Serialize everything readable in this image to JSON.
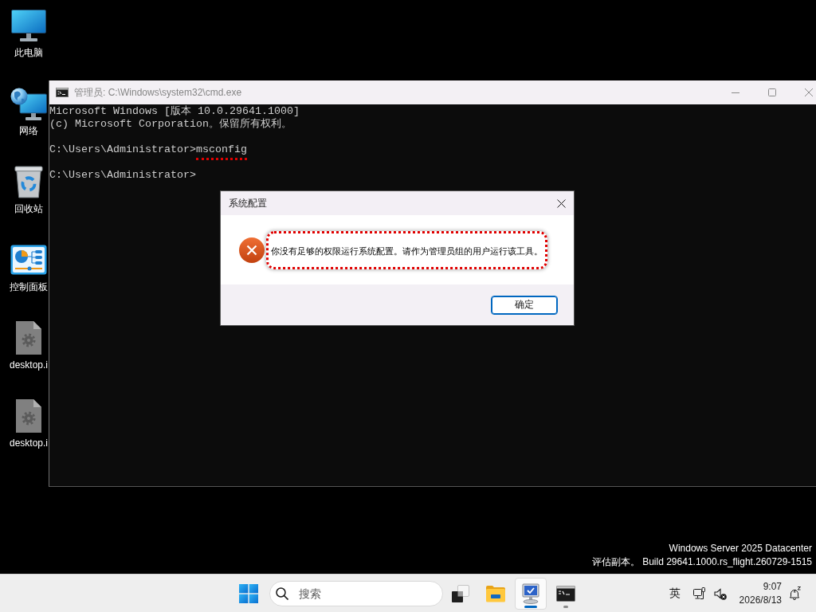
{
  "desktop": {
    "icons": [
      {
        "kind": "computer",
        "label": "此电脑"
      },
      {
        "kind": "network",
        "label": "网络"
      },
      {
        "kind": "recycle-bin",
        "label": "回收站"
      },
      {
        "kind": "control-panel",
        "label": "控制面板"
      },
      {
        "kind": "settings-file",
        "label": "desktop.i"
      },
      {
        "kind": "settings-file",
        "label": "desktop.i"
      }
    ],
    "edition_notice": [
      "Windows Server 2025 Datacenter",
      "评估副本。 Build 29641.1000.rs_flight.260729-1515"
    ]
  },
  "console_window": {
    "title": "管理员: C:\\Windows\\system32\\cmd.exe",
    "lines": [
      {
        "kind": "output",
        "text": "Microsoft Windows [版本 10.0.29641.1000]",
        "highlighted": false
      },
      {
        "kind": "output",
        "text": "(c) Microsoft Corporation。保留所有权利。",
        "highlighted": false
      },
      {
        "kind": "prompt",
        "prompt": "C:\\Users\\Administrator>",
        "command": "msconfig",
        "highlighted": true
      },
      {
        "kind": "prompt",
        "prompt": "C:\\Users\\Administrator>",
        "highlighted": false
      }
    ]
  },
  "dialog": {
    "title": "系统配置",
    "message": {
      "text": "你没有足够的权限运行系统配置。请作为管理员组的用户运行该工具。",
      "highlighted": true
    },
    "buttons": [
      {
        "label": "确定",
        "default": true
      }
    ]
  },
  "taskbar": {
    "search": {
      "placeholder": "搜索"
    },
    "apps": [
      {
        "kind": "task-view",
        "selected": false,
        "running": false
      },
      {
        "kind": "file-explorer",
        "selected": false,
        "running": false
      },
      {
        "kind": "system-configuration",
        "selected": true,
        "running": true
      },
      {
        "kind": "command-prompt",
        "selected": false,
        "running": true
      }
    ],
    "tray": {
      "input_method": "英",
      "volume_muted": true,
      "time": "9:07",
      "date": "2026/8/13"
    }
  }
}
